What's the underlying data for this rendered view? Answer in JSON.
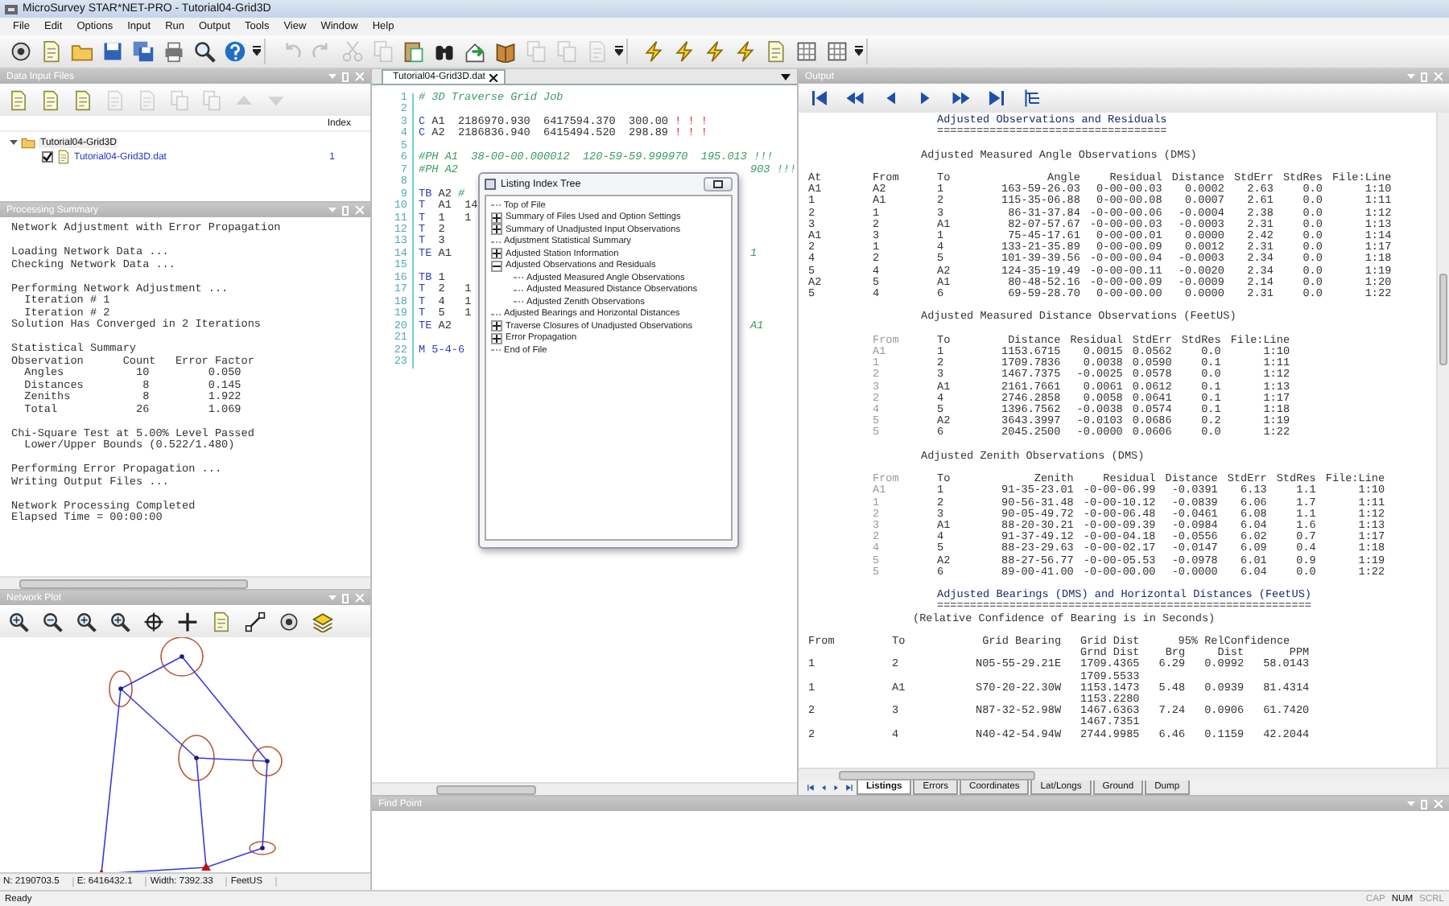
{
  "window": {
    "title": "MicroSurvey STAR*NET-PRO - Tutorial04-Grid3D"
  },
  "menu": [
    "File",
    "Edit",
    "Options",
    "Input",
    "Run",
    "Output",
    "Tools",
    "View",
    "Window",
    "Help"
  ],
  "toolbar": [
    {
      "buttons": [
        {
          "disabled": false
        },
        {
          "disabled": false
        },
        {
          "disabled": false
        },
        {
          "disabled": false
        },
        {
          "disabled": false
        },
        {
          "disabled": false
        },
        {
          "disabled": false
        },
        {
          "disabled": false
        }
      ]
    },
    {
      "buttons": [
        {
          "disabled": true
        },
        {
          "disabled": true
        },
        {
          "disabled": true
        },
        {
          "disabled": true
        },
        {
          "disabled": false
        },
        {
          "disabled": false
        },
        {
          "disabled": false
        },
        {
          "disabled": false
        },
        {
          "disabled": true
        },
        {
          "disabled": true
        },
        {
          "disabled": true
        }
      ]
    },
    {
      "buttons": [
        {
          "disabled": false
        },
        {
          "disabled": false
        },
        {
          "disabled": false
        },
        {
          "disabled": false
        },
        {
          "disabled": false
        },
        {
          "disabled": false
        },
        {
          "disabled": false
        }
      ]
    }
  ],
  "data_input_files": {
    "title": "Data Input Files",
    "toolbar": [
      {
        "disabled": false
      },
      {
        "disabled": false
      },
      {
        "disabled": false
      },
      {
        "disabled": true
      },
      {
        "disabled": true
      },
      {
        "disabled": true
      },
      {
        "disabled": true
      },
      {
        "disabled": true
      },
      {
        "disabled": true
      }
    ],
    "index_header": "Index",
    "project": {
      "label": "Tutorial04-Grid3D",
      "expanded": true,
      "files": [
        {
          "label": "Tutorial04-Grid3D.dat",
          "checked": true,
          "index": "1"
        }
      ]
    }
  },
  "processing_summary": {
    "title": "Processing Summary",
    "paragraphs": [
      [
        "Network Adjustment with Error Propagation"
      ],
      [
        "Loading Network Data ...",
        "Checking Network Data ..."
      ],
      [
        "Performing Network Adjustment ...",
        "  Iteration # 1",
        "  Iteration # 2",
        "Solution Has Converged in 2 Iterations"
      ],
      [
        "Statistical Summary",
        "Observation      Count   Error Factor",
        "  Angles           10         0.050",
        "  Distances         8         0.145",
        "  Zeniths           8         1.922",
        "  Total            26         1.069"
      ],
      [
        "Chi-Square Test at 5.00% Level Passed",
        "  Lower/Upper Bounds (0.522/1.480)"
      ],
      [
        "Performing Error Propagation ...",
        "Writing Output Files ..."
      ],
      [
        "Network Processing Completed",
        "Elapsed Time = 00:00:00"
      ]
    ]
  },
  "network_plot": {
    "title": "Network Plot"
  },
  "plot_status": [
    "N: 2190703.5",
    "E: 6416432.1",
    "Width: 7392.33",
    "FeetUS"
  ],
  "editor": {
    "tab": "Tutorial04-Grid3D.dat",
    "lines": [
      {
        "number": "1",
        "segments": [
          {
            "text": "# 3D Traverse Grid Job",
            "kind": "comment"
          }
        ]
      },
      {
        "number": "2"
      },
      {
        "number": "3",
        "segments": [
          {
            "text": "C",
            "kind": "keyword"
          },
          {
            "text": " A1  2186970.930  6417594.370  300.00 ",
            "kind": "plain"
          },
          {
            "text": "! ! !",
            "kind": "flag"
          }
        ]
      },
      {
        "number": "4",
        "segments": [
          {
            "text": "C",
            "kind": "keyword"
          },
          {
            "text": " A2  2186836.940  6415494.520  298.89 ",
            "kind": "plain"
          },
          {
            "text": "! ! !",
            "kind": "flag"
          }
        ]
      },
      {
        "number": "5"
      },
      {
        "number": "6",
        "segments": [
          {
            "text": "#PH A1  38-00-00.000012  120-59-59.999970  195.013 !!!",
            "kind": "comment"
          }
        ]
      },
      {
        "number": "7",
        "segments": [
          {
            "text": "#PH A2",
            "kind": "comment"
          }
        ],
        "tail": [
          {
            "text": "903 !!!",
            "kind": "comment"
          }
        ]
      },
      {
        "number": "8"
      },
      {
        "number": "9",
        "segments": [
          {
            "text": "TB",
            "kind": "keyword"
          },
          {
            "text": " A2 ",
            "kind": "plain"
          },
          {
            "text": "#",
            "kind": "comment"
          }
        ]
      },
      {
        "number": "10",
        "segments": [
          {
            "text": "T",
            "kind": "keyword"
          },
          {
            "text": "  A1  14",
            "kind": "plain"
          }
        ]
      },
      {
        "number": "11",
        "segments": [
          {
            "text": "T",
            "kind": "keyword"
          },
          {
            "text": "  1   1",
            "kind": "plain"
          }
        ]
      },
      {
        "number": "12",
        "segments": [
          {
            "text": "T",
            "kind": "keyword"
          },
          {
            "text": "  2",
            "kind": "plain"
          }
        ]
      },
      {
        "number": "13",
        "segments": [
          {
            "text": "T",
            "kind": "keyword"
          },
          {
            "text": "  3",
            "kind": "plain"
          }
        ]
      },
      {
        "number": "14",
        "segments": [
          {
            "text": "TE",
            "kind": "keyword"
          },
          {
            "text": " A1",
            "kind": "plain"
          }
        ],
        "tail": [
          {
            "text": "1",
            "kind": "comment"
          }
        ]
      },
      {
        "number": "15"
      },
      {
        "number": "16",
        "segments": [
          {
            "text": "TB",
            "kind": "keyword"
          },
          {
            "text": " 1",
            "kind": "plain"
          }
        ]
      },
      {
        "number": "17",
        "segments": [
          {
            "text": "T",
            "kind": "keyword"
          },
          {
            "text": "  2   1",
            "kind": "plain"
          }
        ]
      },
      {
        "number": "18",
        "segments": [
          {
            "text": "T",
            "kind": "keyword"
          },
          {
            "text": "  4   1",
            "kind": "plain"
          }
        ]
      },
      {
        "number": "19",
        "segments": [
          {
            "text": "T",
            "kind": "keyword"
          },
          {
            "text": "  5   1",
            "kind": "plain"
          }
        ]
      },
      {
        "number": "20",
        "segments": [
          {
            "text": "TE",
            "kind": "keyword"
          },
          {
            "text": " A2",
            "kind": "plain"
          }
        ],
        "tail": [
          {
            "text": "A1",
            "kind": "comment"
          }
        ]
      },
      {
        "number": "21"
      },
      {
        "number": "22",
        "segments": [
          {
            "text": "M 5-4-6",
            "kind": "keyword"
          }
        ]
      },
      {
        "number": "23"
      }
    ]
  },
  "listing_tree": {
    "title": "Listing Index Tree",
    "items": [
      {
        "label": "Top of File",
        "kind": "leaf"
      },
      {
        "label": "Summary of Files Used and Option Settings",
        "kind": "node",
        "expanded": false
      },
      {
        "label": "Summary of Unadjusted Input Observations",
        "kind": "node",
        "expanded": false
      },
      {
        "label": "Adjustment Statistical Summary",
        "kind": "leaf"
      },
      {
        "label": "Adjusted Station Information",
        "kind": "node",
        "expanded": false
      },
      {
        "label": "Adjusted Observations and Residuals",
        "kind": "node",
        "expanded": true,
        "children": [
          {
            "label": "Adjusted Measured Angle Observations",
            "kind": "leaf"
          },
          {
            "label": "Adjusted Measured Distance Observations",
            "kind": "leaf"
          },
          {
            "label": "Adjusted Zenith Observations",
            "kind": "leaf"
          }
        ]
      },
      {
        "label": "Adjusted Bearings and Horizontal Distances",
        "kind": "leaf"
      },
      {
        "label": "Traverse Closures of Unadjusted Observations",
        "kind": "node",
        "expanded": false
      },
      {
        "label": "Error Propagation",
        "kind": "node",
        "expanded": false
      },
      {
        "label": "End of File",
        "kind": "leaf"
      }
    ]
  },
  "output": {
    "title": "Output",
    "blocks": [
      {
        "kind": "title",
        "text": "Adjusted Observations and Residuals",
        "rule": "==================================="
      },
      {
        "kind": "heading",
        "text": "Adjusted Measured Angle Observations (DMS)"
      },
      {
        "kind": "table",
        "indented": false,
        "columns": [
          {
            "label": "At",
            "kind": "station"
          },
          {
            "label": "From",
            "kind": "station"
          },
          {
            "label": "To",
            "kind": "station"
          },
          {
            "label": "Angle",
            "kind": "value"
          },
          {
            "label": "Residual",
            "kind": "value"
          },
          {
            "label": "Distance",
            "kind": "value"
          },
          {
            "label": "StdErr",
            "kind": "value"
          },
          {
            "label": "StdRes",
            "kind": "value"
          },
          {
            "label": "File:Line",
            "kind": "value"
          }
        ],
        "rows": [
          [
            "A1",
            "A2",
            "1",
            "163-59-26.03",
            "0-00-00.03",
            "0.0002",
            "2.63",
            "0.0",
            "1:10"
          ],
          [
            "1",
            "A1",
            "2",
            "115-35-06.88",
            "0-00-00.08",
            "0.0007",
            "2.61",
            "0.0",
            "1:11"
          ],
          [
            "2",
            "1",
            "3",
            "86-31-37.84",
            "-0-00-00.06",
            "-0.0004",
            "2.38",
            "0.0",
            "1:12"
          ],
          [
            "3",
            "2",
            "A1",
            "82-07-57.67",
            "-0-00-00.03",
            "-0.0003",
            "2.31",
            "0.0",
            "1:13"
          ],
          [
            "A1",
            "3",
            "1",
            "75-45-17.61",
            "0-00-00.01",
            "0.0000",
            "2.42",
            "0.0",
            "1:14"
          ],
          [
            "2",
            "1",
            "4",
            "133-21-35.89",
            "0-00-00.09",
            "0.0012",
            "2.31",
            "0.0",
            "1:17"
          ],
          [
            "4",
            "2",
            "5",
            "101-39-39.56",
            "-0-00-00.04",
            "-0.0003",
            "2.34",
            "0.0",
            "1:18"
          ],
          [
            "5",
            "4",
            "A2",
            "124-35-19.49",
            "-0-00-00.11",
            "-0.0020",
            "2.34",
            "0.0",
            "1:19"
          ],
          [
            "A2",
            "5",
            "A1",
            "80-48-52.16",
            "-0-00-00.09",
            "-0.0009",
            "2.14",
            "0.0",
            "1:20"
          ],
          [
            "5",
            "4",
            "6",
            "69-59-28.70",
            "0-00-00.00",
            "0.0000",
            "2.31",
            "0.0",
            "1:22"
          ]
        ]
      },
      {
        "kind": "heading",
        "text": "Adjusted Measured Distance Observations (FeetUS)"
      },
      {
        "kind": "table",
        "indented": true,
        "columns": [
          {
            "label": "From",
            "kind": "station"
          },
          {
            "label": "To",
            "kind": "station"
          },
          {
            "label": "Distance",
            "kind": "value"
          },
          {
            "label": "Residual",
            "kind": "value"
          },
          {
            "label": "StdErr",
            "kind": "value"
          },
          {
            "label": "StdRes",
            "kind": "value"
          },
          {
            "label": "File:Line",
            "kind": "value"
          }
        ],
        "rows": [
          [
            "A1",
            "1",
            "1153.6715",
            "0.0015",
            "0.0562",
            "0.0",
            "1:10"
          ],
          [
            "1",
            "2",
            "1709.7836",
            "0.0038",
            "0.0590",
            "0.1",
            "1:11"
          ],
          [
            "2",
            "3",
            "1467.7375",
            "-0.0025",
            "0.0578",
            "0.0",
            "1:12"
          ],
          [
            "3",
            "A1",
            "2161.7661",
            "0.0061",
            "0.0612",
            "0.1",
            "1:13"
          ],
          [
            "2",
            "4",
            "2746.2858",
            "0.0058",
            "0.0641",
            "0.1",
            "1:17"
          ],
          [
            "4",
            "5",
            "1396.7562",
            "-0.0038",
            "0.0574",
            "0.1",
            "1:18"
          ],
          [
            "5",
            "A2",
            "3643.3997",
            "-0.0103",
            "0.0686",
            "0.2",
            "1:19"
          ],
          [
            "5",
            "6",
            "2045.2500",
            "-0.0000",
            "0.0606",
            "0.0",
            "1:22"
          ]
        ]
      },
      {
        "kind": "heading",
        "text": "Adjusted Zenith Observations (DMS)"
      },
      {
        "kind": "table",
        "indented": true,
        "columns": [
          {
            "label": "From",
            "kind": "station"
          },
          {
            "label": "To",
            "kind": "station"
          },
          {
            "label": "Zenith",
            "kind": "value"
          },
          {
            "label": "Residual",
            "kind": "value"
          },
          {
            "label": "Distance",
            "kind": "value"
          },
          {
            "label": "StdErr",
            "kind": "value"
          },
          {
            "label": "StdRes",
            "kind": "value"
          },
          {
            "label": "File:Line",
            "kind": "value"
          }
        ],
        "rows": [
          [
            "A1",
            "1",
            "91-35-23.01",
            "-0-00-06.99",
            "-0.0391",
            "6.13",
            "1.1",
            "1:10"
          ],
          [
            "1",
            "2",
            "90-56-31.48",
            "-0-00-10.12",
            "-0.0839",
            "6.06",
            "1.7",
            "1:11"
          ],
          [
            "2",
            "3",
            "90-05-49.72",
            "-0-00-06.48",
            "-0.0461",
            "6.08",
            "1.1",
            "1:12"
          ],
          [
            "3",
            "A1",
            "88-20-30.21",
            "-0-00-09.39",
            "-0.0984",
            "6.04",
            "1.6",
            "1:13"
          ],
          [
            "2",
            "4",
            "91-37-49.12",
            "-0-00-04.18",
            "-0.0556",
            "6.02",
            "0.7",
            "1:17"
          ],
          [
            "4",
            "5",
            "88-23-29.63",
            "-0-00-02.17",
            "-0.0147",
            "6.09",
            "0.4",
            "1:18"
          ],
          [
            "5",
            "A2",
            "88-27-56.77",
            "-0-00-05.53",
            "-0.0978",
            "6.01",
            "0.9",
            "1:19"
          ],
          [
            "5",
            "6",
            "89-00-41.00",
            "-0-00-00.00",
            "-0.0000",
            "6.04",
            "0.0",
            "1:22"
          ]
        ]
      },
      {
        "kind": "title",
        "text": "Adjusted Bearings (DMS) and Horizontal Distances (FeetUS)",
        "rule": "========================================================="
      },
      {
        "kind": "note",
        "text": "(Relative Confidence of Bearing is in Seconds)"
      },
      {
        "kind": "bearings",
        "group_label": "95% RelConfidence",
        "columns": [
          {
            "label": "From",
            "kind": "station"
          },
          {
            "label": "To",
            "kind": "station"
          },
          {
            "label": "Grid Bearing",
            "kind": "value"
          },
          {
            "label": "Grid Dist",
            "sublabel": "Grnd Dist",
            "kind": "value"
          },
          {
            "sublabel": "Brg",
            "kind": "value"
          },
          {
            "sublabel": "Dist",
            "kind": "value"
          },
          {
            "sublabel": "PPM",
            "kind": "value"
          }
        ],
        "rows": [
          {
            "cells": [
              "1",
              "2",
              "N05-55-29.21E",
              "1709.4365",
              "6.29",
              "0.0992",
              "58.0143"
            ],
            "ground": "1709.5533"
          },
          {
            "cells": [
              "1",
              "A1",
              "S70-20-22.30W",
              "1153.1473",
              "5.48",
              "0.0939",
              "81.4314"
            ],
            "ground": "1153.2280"
          },
          {
            "cells": [
              "2",
              "3",
              "N87-32-52.98W",
              "1467.6363",
              "7.24",
              "0.0906",
              "61.7420"
            ],
            "ground": "1467.7351"
          },
          {
            "cells": [
              "2",
              "4",
              "N40-42-54.94W",
              "2744.9985",
              "6.46",
              "0.1159",
              "42.2044"
            ]
          }
        ]
      }
    ],
    "tabs": [
      {
        "label": "Listings",
        "selected": true
      },
      {
        "label": "Errors",
        "selected": false
      },
      {
        "label": "Coordinates",
        "selected": false
      },
      {
        "label": "Lat/Longs",
        "selected": false
      },
      {
        "label": "Ground",
        "selected": false
      },
      {
        "label": "Dump",
        "selected": false
      }
    ]
  },
  "find_point": {
    "title": "Find Point"
  },
  "status_bar": {
    "text": "Ready",
    "indicators": [
      {
        "label": "CAP",
        "on": false
      },
      {
        "label": "NUM",
        "on": true
      },
      {
        "label": "SCRL",
        "on": false
      }
    ]
  }
}
